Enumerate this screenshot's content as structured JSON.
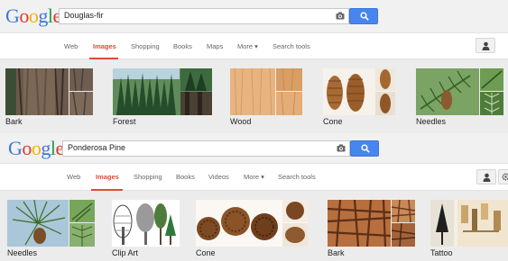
{
  "colors": {
    "accent": "#dd4b39",
    "button_blue": "#4786ee",
    "topbar_bg": "#f1f1f1",
    "strip_bg": "#ececec"
  },
  "logo": {
    "letters": [
      "G",
      "o",
      "o",
      "g",
      "l",
      "e"
    ]
  },
  "panels": [
    {
      "query": "Douglas-fir",
      "nav": [
        "Web",
        "Images",
        "Shopping",
        "Books",
        "Maps",
        "More ▾",
        "Search tools"
      ],
      "active_tab": "Images",
      "tiles": [
        {
          "label": "Bark",
          "icon": "bark-thumbnail"
        },
        {
          "label": "Forest",
          "icon": "forest-thumbnail"
        },
        {
          "label": "Wood",
          "icon": "wood-thumbnail"
        },
        {
          "label": "Cone",
          "icon": "cone-thumbnail"
        },
        {
          "label": "Needles",
          "icon": "needles-thumbnail"
        }
      ]
    },
    {
      "query": "Ponderosa Pine",
      "nav": [
        "Web",
        "Images",
        "Shopping",
        "Books",
        "Videos",
        "More ▾",
        "Search tools"
      ],
      "active_tab": "Images",
      "tiles": [
        {
          "label": "Needles",
          "icon": "needles-thumbnail"
        },
        {
          "label": "Clip Art",
          "icon": "clip-art-thumbnail"
        },
        {
          "label": "Cone",
          "icon": "cone-thumbnail"
        },
        {
          "label": "Bark",
          "icon": "bark-thumbnail"
        },
        {
          "label": "Tattoo",
          "icon": "tattoo-thumbnail"
        }
      ]
    }
  ],
  "icons": {
    "camera": "camera-icon",
    "search": "search-icon",
    "user": "user-icon",
    "gear": "gear-icon"
  }
}
